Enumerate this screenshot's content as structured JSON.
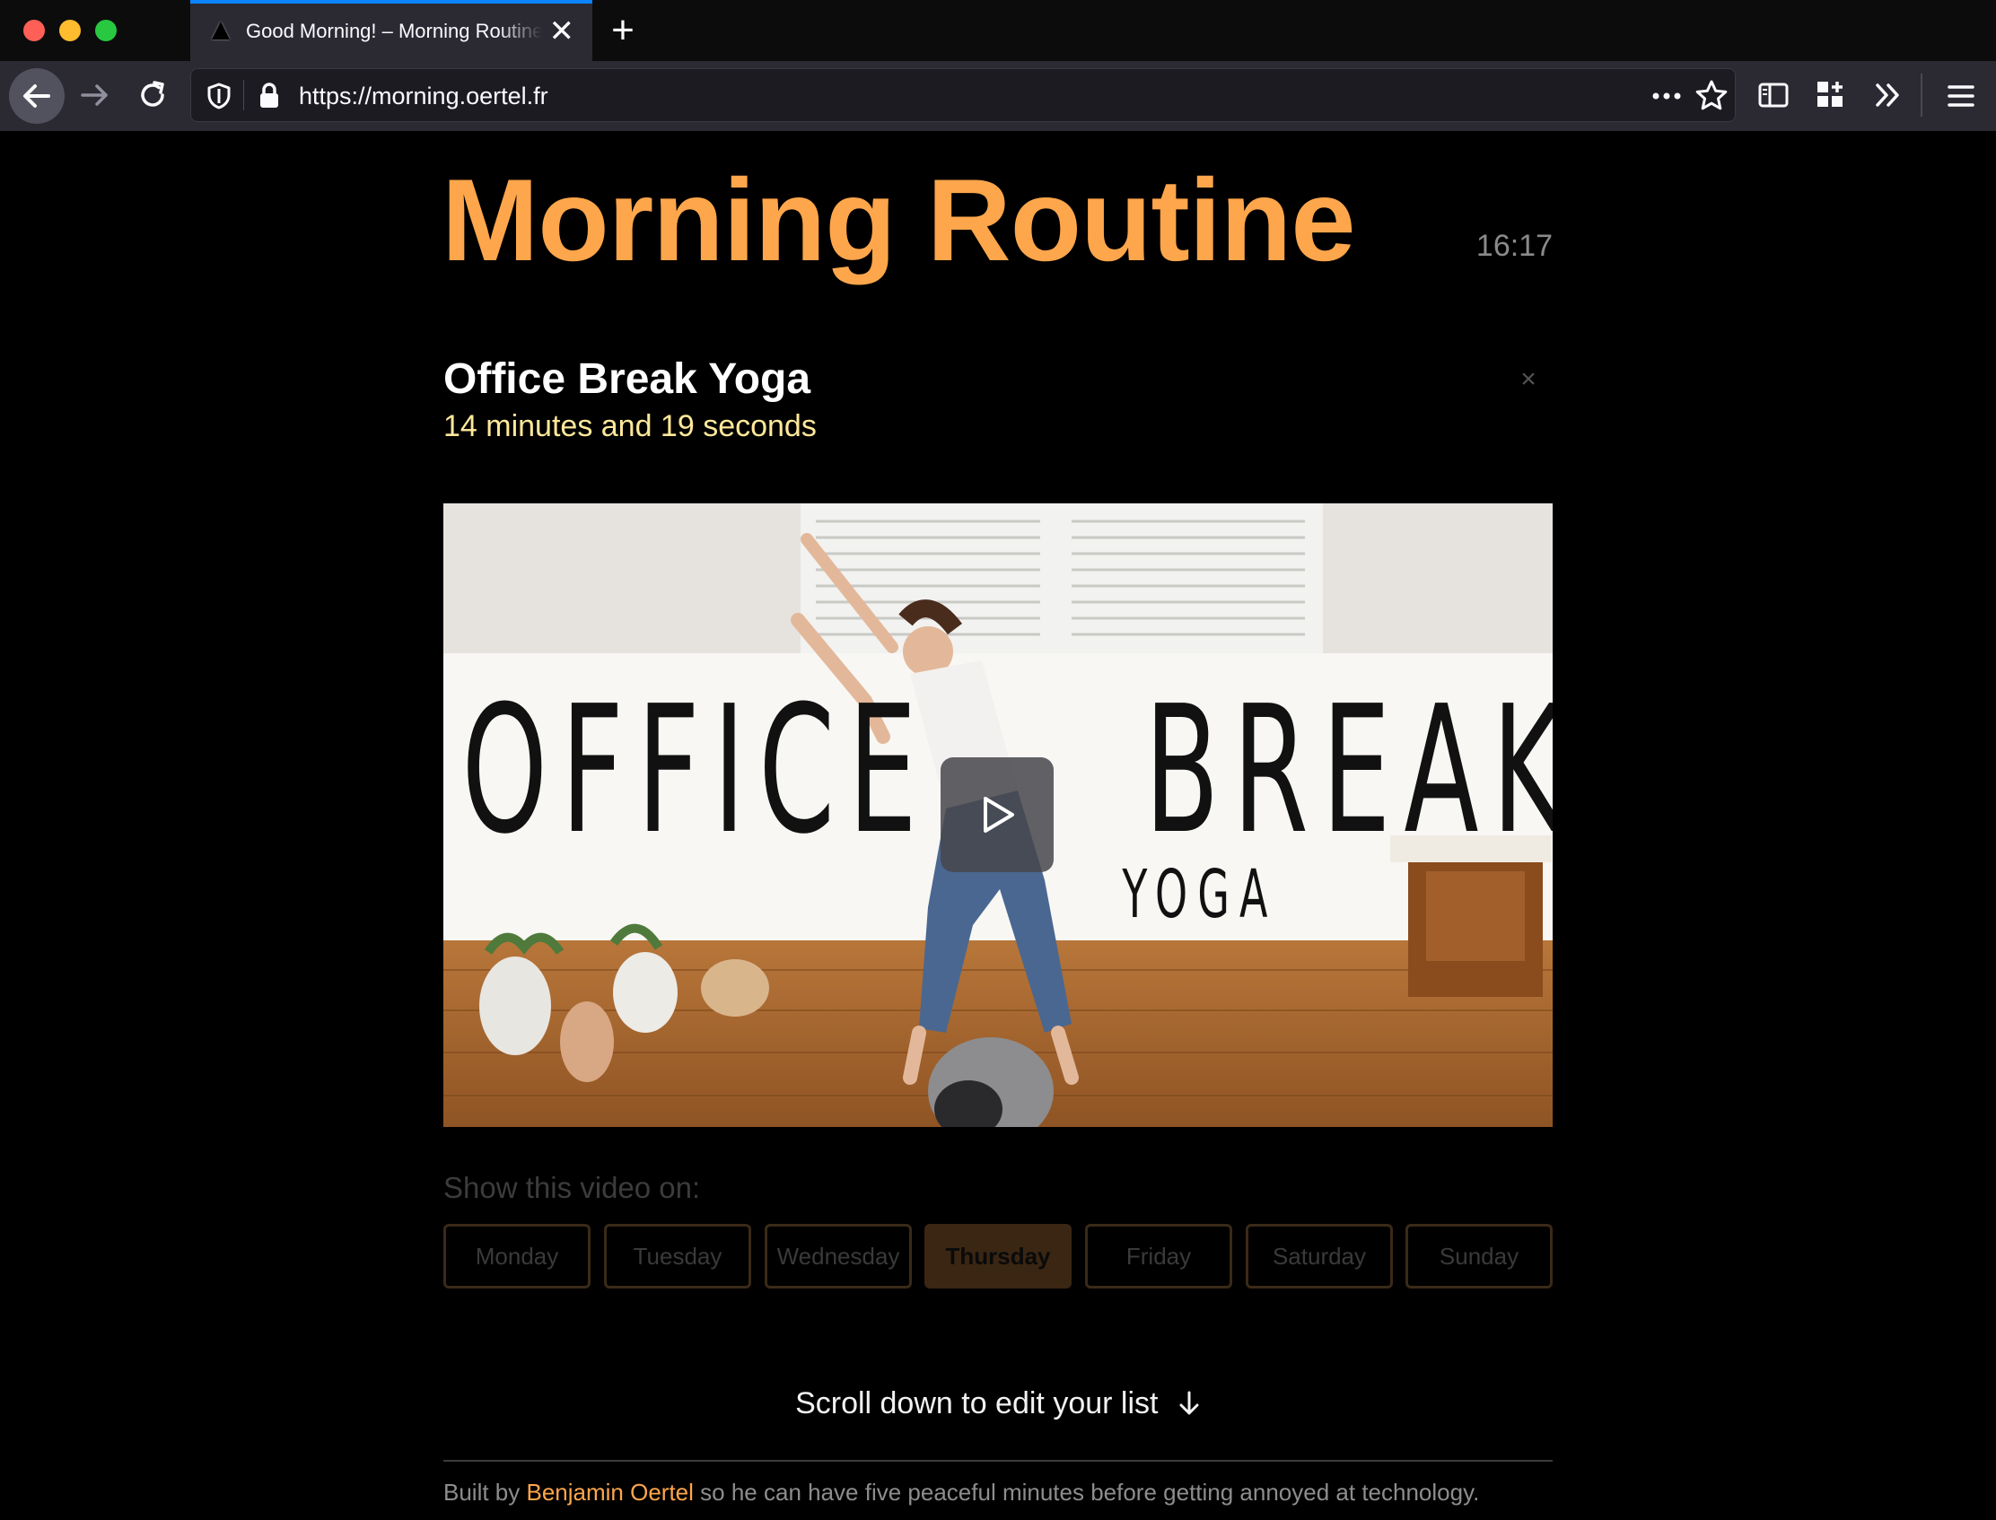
{
  "browser": {
    "tab_title": "Good Morning! – Morning Routine",
    "tab_close": "✕",
    "new_tab": "+",
    "url": "https://morning.oertel.fr",
    "accent_color": "#0a84ff"
  },
  "page": {
    "title": "Morning Routine",
    "time": "16:17",
    "title_color": "#fea64b"
  },
  "video": {
    "title": "Office Break Yoga",
    "duration": "14 minutes and 19 seconds",
    "close": "×",
    "thumbnail": {
      "word_left": "OFFICE",
      "word_right": "BREAK",
      "word_sub": "YOGA"
    },
    "show_label": "Show this video on:",
    "days": [
      "Monday",
      "Tuesday",
      "Wednesday",
      "Thursday",
      "Friday",
      "Saturday",
      "Sunday"
    ],
    "selected_day": "Thursday"
  },
  "scroll_hint": "Scroll down to edit your list",
  "scroll_icon": "arrow-down-icon",
  "footer": {
    "prefix": "Built by",
    "author": "Benjamin Oertel",
    "suffix": "so he can have five peaceful minutes before getting annoyed at technology."
  }
}
